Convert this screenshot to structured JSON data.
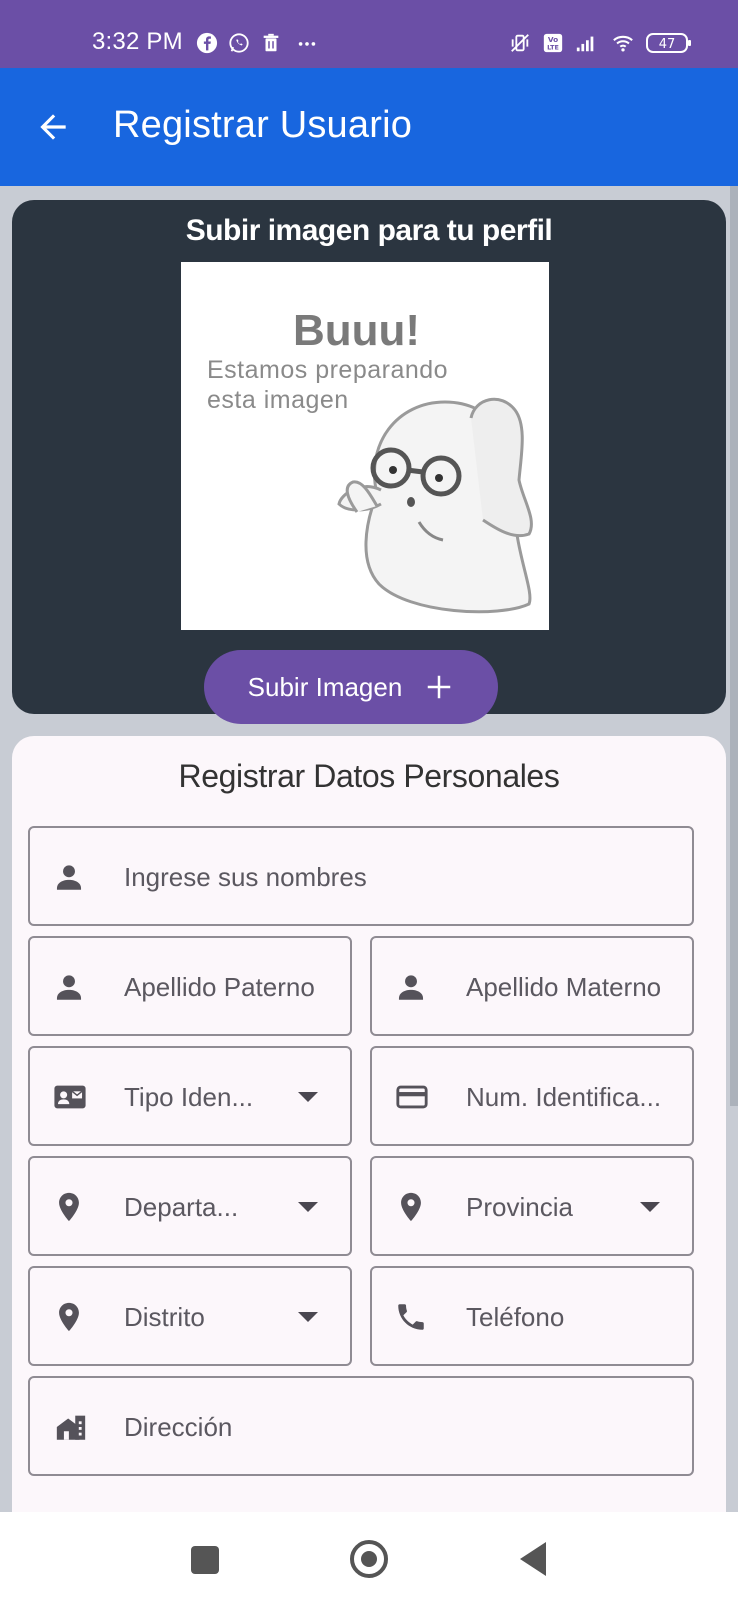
{
  "status_bar": {
    "time": "3:32 PM",
    "battery": "47",
    "network_badge": "Vo LTE",
    "left_icons": [
      "facebook-icon",
      "whatsapp-icon",
      "trash-icon",
      "more-dots-icon"
    ],
    "right_icons": [
      "vibrate-off-icon",
      "volte-icon",
      "signal-icon",
      "wifi-icon",
      "battery-icon"
    ]
  },
  "app_bar": {
    "title": "Registrar Usuario",
    "back_icon": "arrow-back-icon"
  },
  "image_section": {
    "title": "Subir imagen para tu perfil",
    "placeholder_title": "Buuu!",
    "placeholder_line1": "Estamos preparando",
    "placeholder_line2": "esta imagen",
    "upload_button_label": "Subir Imagen"
  },
  "form": {
    "title": "Registrar Datos Personales",
    "fields": {
      "nombres": "Ingrese sus nombres",
      "apellido_paterno": "Apellido Paterno",
      "apellido_materno": "Apellido Materno",
      "tipo_identificacion": "Tipo Iden...",
      "num_identificacion": "Num. Identifica...",
      "departamento": "Departa...",
      "provincia": "Provincia",
      "distrito": "Distrito",
      "telefono": "Teléfono",
      "direccion": "Dirección"
    }
  },
  "colors": {
    "status_bar": "#6b4fa6",
    "app_bar": "#1866df",
    "image_card": "#2b3540",
    "accent_button": "#6b4fa6",
    "form_card": "#fcf7fb",
    "background": "#c8ccd4"
  }
}
